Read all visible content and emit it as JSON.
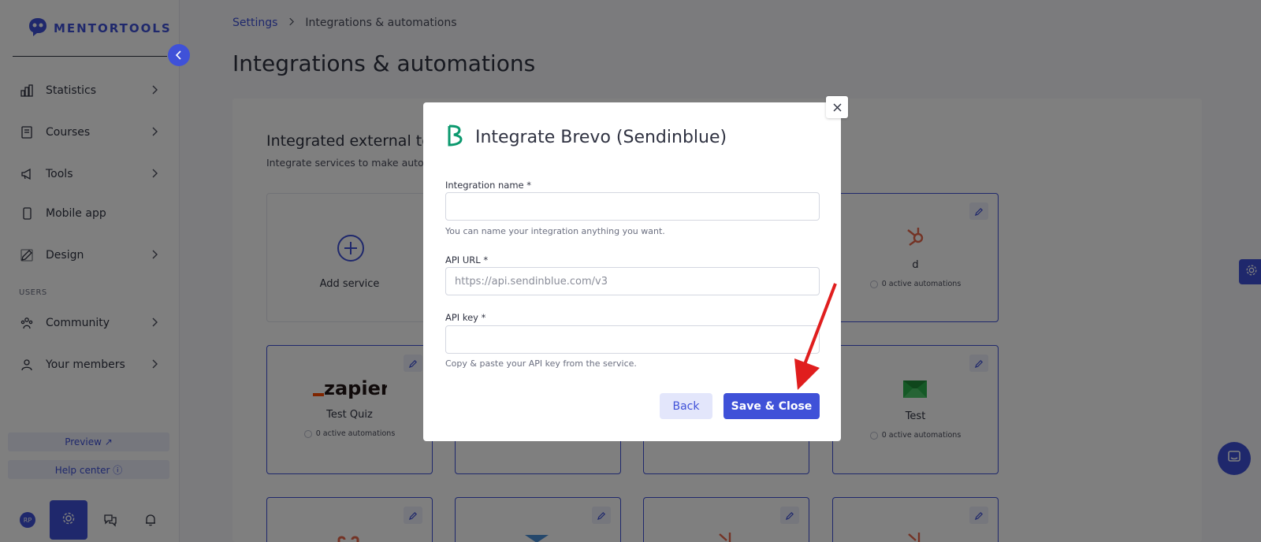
{
  "brand": {
    "name": "MENTORTOOLS",
    "accent": "#3f51d8"
  },
  "sidebar": {
    "items": [
      {
        "label": "Statistics",
        "icon": "bar-chart-icon"
      },
      {
        "label": "Courses",
        "icon": "book-icon"
      },
      {
        "label": "Tools",
        "icon": "megaphone-icon"
      },
      {
        "label": "Mobile app",
        "icon": "phone-icon"
      },
      {
        "label": "Design",
        "icon": "pencil-icon"
      }
    ],
    "section_label": "USERS",
    "user_items": [
      {
        "label": "Community",
        "icon": "people-icon"
      },
      {
        "label": "Your members",
        "icon": "user-icon"
      }
    ],
    "preview_label": "Preview ↗",
    "help_label": "Help center ⓘ",
    "avatar_initials": "RP"
  },
  "breadcrumb": {
    "root": "Settings",
    "current": "Integrations & automations"
  },
  "page_title": "Integrations & automations",
  "panel": {
    "title": "Integrated external tools",
    "subtitle": "Integrate services to make automations"
  },
  "cards": {
    "add_service": "Add service",
    "hubspot_name": "d",
    "zapier_name": "Test Quiz",
    "mail_name": "Test",
    "automations_text": "0 active automations"
  },
  "modal": {
    "title": "Integrate Brevo (Sendinblue)",
    "integration_name_label": "Integration name *",
    "integration_name_value": "",
    "integration_name_help": "You can name your integration anything you want.",
    "api_url_label": "API URL *",
    "api_url_placeholder": "https://api.sendinblue.com/v3",
    "api_key_label": "API key *",
    "api_key_value": "",
    "api_key_help": "Copy & paste your API key from the service.",
    "back_label": "Back",
    "save_label": "Save & Close"
  }
}
